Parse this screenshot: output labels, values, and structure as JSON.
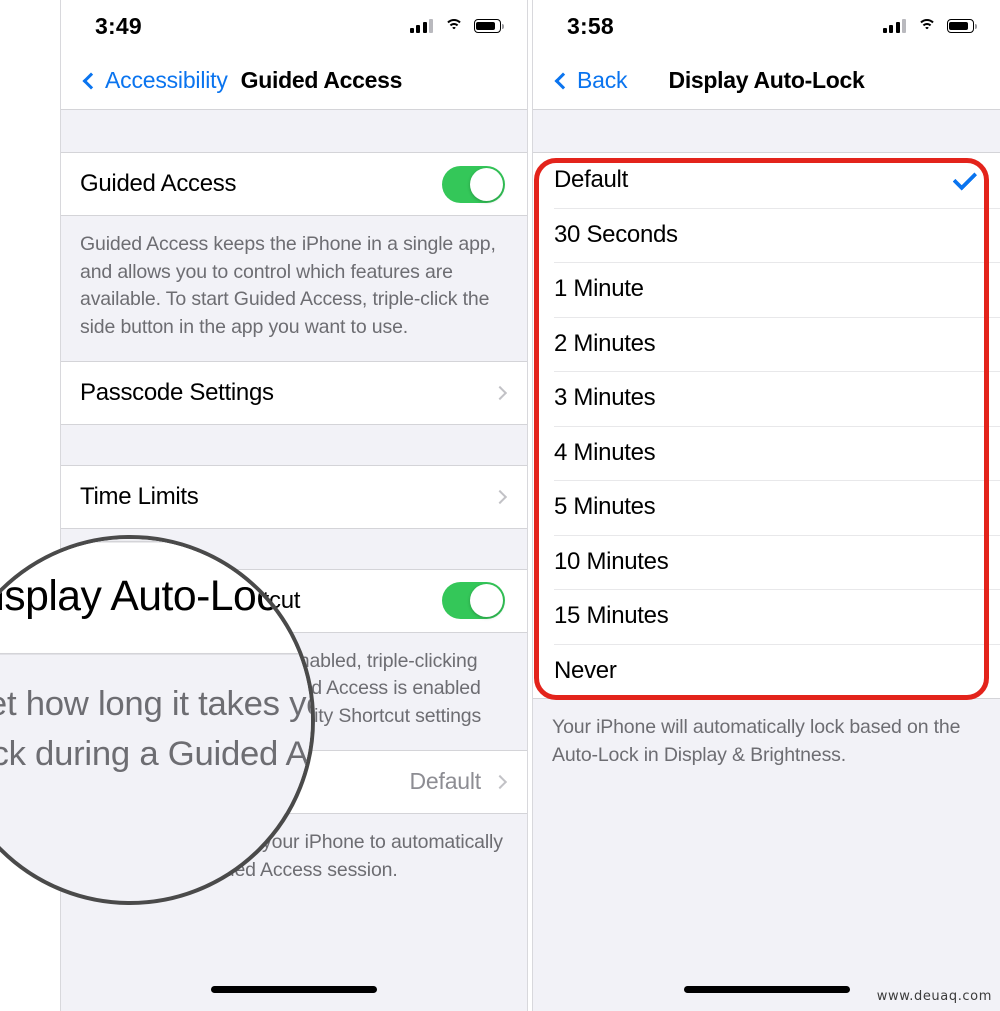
{
  "left_phone": {
    "status_bar": {
      "time": "3:49",
      "signal_icon": "cellular-signal-icon",
      "wifi_icon": "wifi-icon",
      "battery_icon": "battery-icon"
    },
    "nav": {
      "back_label": "Accessibility",
      "title": "Guided Access",
      "back_icon": "chevron-left-icon"
    },
    "rows": {
      "guided_access": {
        "label": "Guided Access",
        "toggle_state": "on"
      },
      "guided_access_footnote": "Guided Access keeps the iPhone in a single app, and allows you to control which features are available. To start Guided Access, triple-click the side button in the app you want to use.",
      "passcode_settings": {
        "label": "Passcode Settings",
        "chevron_icon": "chevron-right-icon"
      },
      "time_limits": {
        "label": "Time Limits",
        "chevron_icon": "chevron-right-icon"
      },
      "accessibility_shortcut": {
        "label": "Accessibility Shortcut",
        "toggle_state": "on"
      },
      "accessibility_shortcut_footnote": "When Guided Access is enabled, triple-clicking the side button while Guided Access is enabled will be displayed. Accessibility Shortcut settings",
      "display_auto_lock": {
        "label": "Display Auto-Lock",
        "value": "Default",
        "chevron_icon": "chevron-right-icon"
      },
      "display_auto_lock_footnote": "Set how long it takes your iPhone to automatically lock during a Guided Access session."
    },
    "magnifier": {
      "icon": "magnifier-circle"
    }
  },
  "right_phone": {
    "status_bar": {
      "time": "3:58",
      "signal_icon": "cellular-signal-icon",
      "wifi_icon": "wifi-icon",
      "battery_icon": "battery-icon"
    },
    "nav": {
      "back_label": "Back",
      "title": "Display Auto-Lock",
      "back_icon": "chevron-left-icon"
    },
    "options": [
      {
        "label": "Default",
        "selected": true
      },
      {
        "label": "30 Seconds",
        "selected": false
      },
      {
        "label": "1 Minute",
        "selected": false
      },
      {
        "label": "2 Minutes",
        "selected": false
      },
      {
        "label": "3 Minutes",
        "selected": false
      },
      {
        "label": "4 Minutes",
        "selected": false
      },
      {
        "label": "5 Minutes",
        "selected": false
      },
      {
        "label": "10 Minutes",
        "selected": false
      },
      {
        "label": "15 Minutes",
        "selected": false
      },
      {
        "label": "Never",
        "selected": false
      }
    ],
    "footnote": "Your iPhone will automatically lock based on the Auto-Lock in Display & Brightness.",
    "callout": {
      "shape": "rounded-rectangle",
      "color": "#e3231b"
    }
  },
  "watermark": "www.deuaq.com",
  "colors": {
    "accent_blue": "#0a74ef",
    "toggle_green": "#34c759",
    "callout_red": "#e3231b",
    "group_bg": "#f2f2f7",
    "secondary_text": "#6d6d72"
  }
}
